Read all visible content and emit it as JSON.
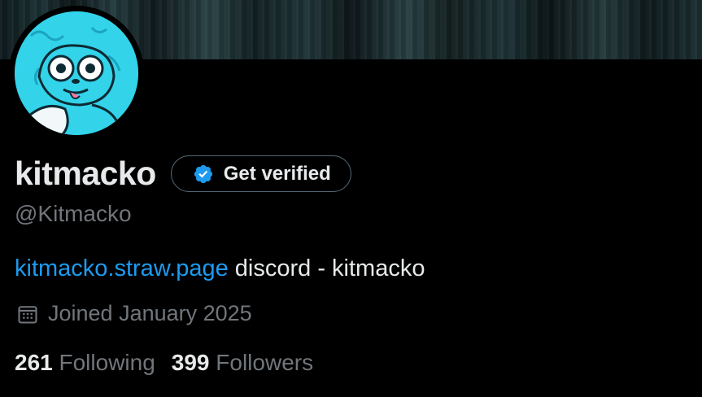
{
  "profile": {
    "display_name": "kitmacko",
    "handle": "@Kitmacko",
    "verify_button_label": "Get verified",
    "bio": {
      "link_text": "kitmacko.straw.page",
      "text": " discord - kitmacko"
    },
    "joined": "Joined January 2025",
    "following_count": "261",
    "following_label": "Following",
    "followers_count": "399",
    "followers_label": "Followers"
  },
  "colors": {
    "background": "#000000",
    "text_primary": "#e7e9ea",
    "text_secondary": "#71767b",
    "link": "#1d9bf0",
    "verified_badge": "#1d9bf0",
    "avatar_bg": "#33d3ea"
  },
  "icons": {
    "verified": "verified-badge-icon",
    "calendar": "calendar-icon"
  }
}
